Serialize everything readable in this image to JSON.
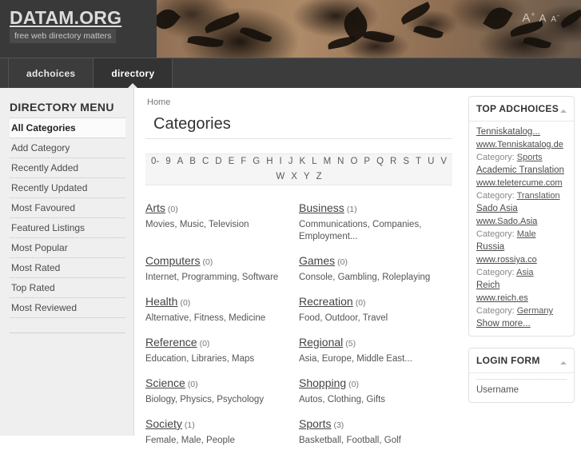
{
  "site": {
    "logo": "DATAM.ORG",
    "slogan": "free web directory matters"
  },
  "fontsizer": {
    "increase": "A",
    "increase_sup": "+",
    "normal": "A",
    "decrease": "A",
    "decrease_sup": "-"
  },
  "nav": {
    "tabs": [
      {
        "label": "adchoices",
        "active": false
      },
      {
        "label": "directory",
        "active": true
      }
    ]
  },
  "sidebar": {
    "title": "DIRECTORY MENU",
    "items": [
      {
        "label": "All Categories",
        "current": true
      },
      {
        "label": "Add Category",
        "current": false
      },
      {
        "label": "Recently Added",
        "current": false
      },
      {
        "label": "Recently Updated",
        "current": false
      },
      {
        "label": "Most Favoured",
        "current": false
      },
      {
        "label": "Featured Listings",
        "current": false
      },
      {
        "label": "Most Popular",
        "current": false
      },
      {
        "label": "Most Rated",
        "current": false
      },
      {
        "label": "Top Rated",
        "current": false
      },
      {
        "label": "Most Reviewed",
        "current": false
      }
    ]
  },
  "main": {
    "breadcrumb": "Home",
    "title": "Categories",
    "alphabet": [
      "0-",
      "9",
      "A",
      "B",
      "C",
      "D",
      "E",
      "F",
      "G",
      "H",
      "I",
      "J",
      "K",
      "L",
      "M",
      "N",
      "O",
      "P",
      "Q",
      "R",
      "S",
      "T",
      "U",
      "V",
      "W",
      "X",
      "Y",
      "Z"
    ],
    "categories": [
      {
        "name": "Arts",
        "count": "(0)",
        "subs": "Movies, Music, Television"
      },
      {
        "name": "Business",
        "count": "(1)",
        "subs": "Communications, Companies, Employment..."
      },
      {
        "name": "Computers",
        "count": "(0)",
        "subs": "Internet, Programming, Software"
      },
      {
        "name": "Games",
        "count": "(0)",
        "subs": "Console, Gambling, Roleplaying"
      },
      {
        "name": "Health",
        "count": "(0)",
        "subs": "Alternative, Fitness, Medicine"
      },
      {
        "name": "Recreation",
        "count": "(0)",
        "subs": "Food, Outdoor, Travel"
      },
      {
        "name": "Reference",
        "count": "(0)",
        "subs": "Education, Libraries, Maps"
      },
      {
        "name": "Regional",
        "count": "(5)",
        "subs": "Asia, Europe, Middle East..."
      },
      {
        "name": "Science",
        "count": "(0)",
        "subs": "Biology, Physics, Psychology"
      },
      {
        "name": "Shopping",
        "count": "(0)",
        "subs": "Autos, Clothing, Gifts"
      },
      {
        "name": "Society",
        "count": "(1)",
        "subs": "Female, Male, People"
      },
      {
        "name": "Sports",
        "count": "(3)",
        "subs": "Basketball, Football, Golf"
      }
    ]
  },
  "rightcol": {
    "adchoices": {
      "title": "TOP ADCHOICES",
      "items": [
        {
          "title": "Tenniskatalog...",
          "url": "www.Tenniskatalog.de",
          "category_label": "Category:",
          "category": "Sports"
        },
        {
          "title": "Academic Translation",
          "url": "www.teletercume.com",
          "category_label": "Category:",
          "category": "Translation"
        },
        {
          "title": "Sado Asia",
          "url": "www.Sado.Asia",
          "category_label": "Category:",
          "category": "Male"
        },
        {
          "title": "Russia",
          "url": "www.rossiya.co",
          "category_label": "Category:",
          "category": "Asia"
        },
        {
          "title": "Reich",
          "url": "www.reich.es",
          "category_label": "Category:",
          "category": "Germany"
        }
      ],
      "show_more": "Show more..."
    },
    "login": {
      "title": "LOGIN FORM",
      "username_label": "Username"
    }
  }
}
